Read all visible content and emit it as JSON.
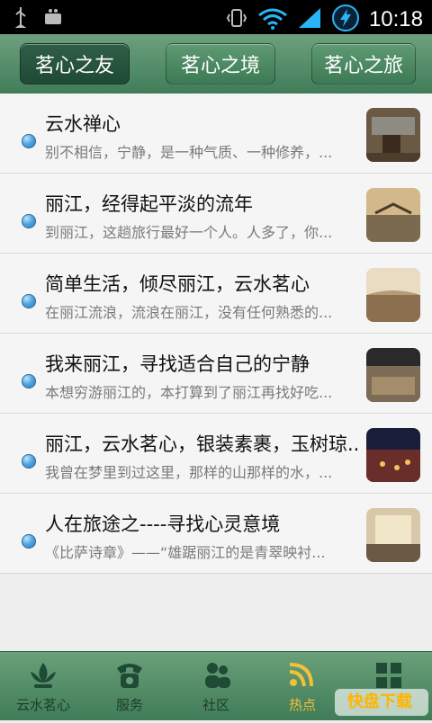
{
  "status": {
    "time": "10:18"
  },
  "top_tabs": [
    {
      "label": "茗心之友"
    },
    {
      "label": "茗心之境"
    },
    {
      "label": "茗心之旅"
    }
  ],
  "items": [
    {
      "title": "云水禅心",
      "desc": "别不相信，宁静，是一种气质、一种修养，..."
    },
    {
      "title": "丽江，经得起平淡的流年",
      "desc": "到丽江，这趟旅行最好一个人。人多了，你..."
    },
    {
      "title": "简单生活，倾尽丽江，云水茗心",
      "desc": "在丽江流浪，流浪在丽江，没有任何熟悉的..."
    },
    {
      "title": "我来丽江，寻找适合自己的宁静",
      "desc": "本想穷游丽江的，本打算到了丽江再找好吃..."
    },
    {
      "title": "丽江，云水茗心，银装素裹，玉树琼...",
      "desc": "我曾在梦里到过这里，那样的山那样的水，..."
    },
    {
      "title": "人在旅途之----寻找心灵意境",
      "desc": "《比萨诗章》——“雄踞丽江的是青翠映衬..."
    }
  ],
  "bottom_tabs": [
    {
      "label": "云水茗心",
      "icon": "lotus-icon"
    },
    {
      "label": "服务",
      "icon": "phone-icon"
    },
    {
      "label": "社区",
      "icon": "people-icon"
    },
    {
      "label": "热点",
      "icon": "rss-icon"
    },
    {
      "label": "",
      "icon": "grid-icon"
    }
  ],
  "brand": {
    "text": "快盘下载"
  }
}
